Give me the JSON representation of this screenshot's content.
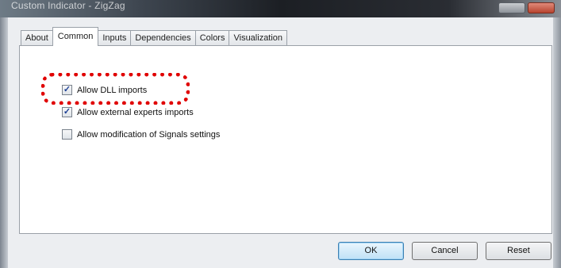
{
  "window": {
    "title": "Custom Indicator - ZigZag"
  },
  "tabs": [
    {
      "label": "About"
    },
    {
      "label": "Common"
    },
    {
      "label": "Inputs"
    },
    {
      "label": "Dependencies"
    },
    {
      "label": "Colors"
    },
    {
      "label": "Visualization"
    }
  ],
  "active_tab": "Common",
  "options": [
    {
      "label": "Allow DLL imports",
      "checked": true
    },
    {
      "label": "Allow external experts imports",
      "checked": true
    },
    {
      "label": "Allow modification of Signals settings",
      "checked": false
    }
  ],
  "buttons": {
    "ok": "OK",
    "cancel": "Cancel",
    "reset": "Reset"
  },
  "colors": {
    "highlight": "#e00000",
    "checkmark": "#1c3f94"
  }
}
